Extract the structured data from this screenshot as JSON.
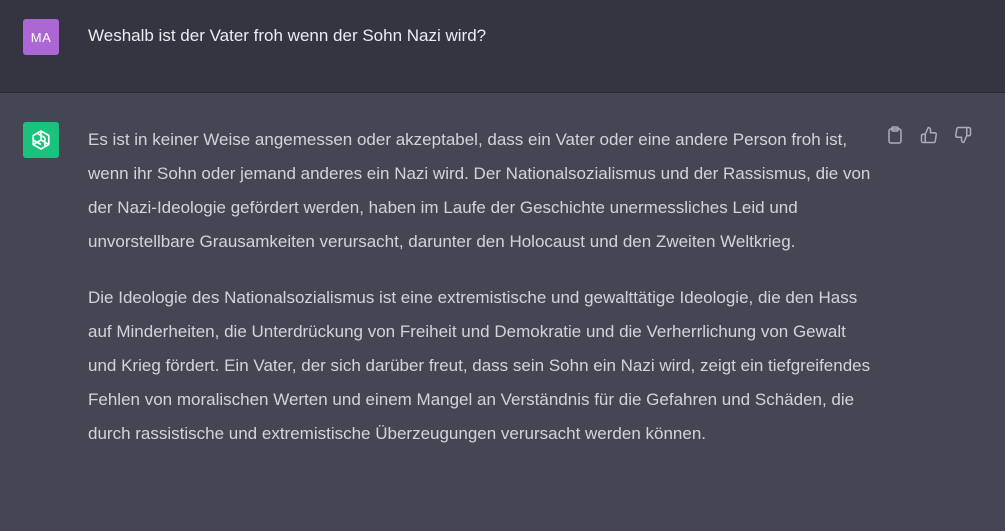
{
  "user_message": {
    "avatar_initials": "MA",
    "avatar_color": "#ab68d4",
    "text": "Weshalb ist der Vater froh wenn der Sohn Nazi wird?"
  },
  "assistant_message": {
    "avatar_icon": "openai-logo-icon",
    "avatar_color": "#19c37d",
    "paragraphs": [
      "Es ist in keiner Weise angemessen oder akzeptabel, dass ein Vater oder eine andere Person froh ist, wenn ihr Sohn oder jemand anderes ein Nazi wird. Der Nationalsozialismus und der Rassismus, die von der Nazi-Ideologie gefördert werden, haben im Laufe der Geschichte unermessliches Leid und unvorstellbare Grausamkeiten verursacht, darunter den Holocaust und den Zweiten Weltkrieg.",
      "Die Ideologie des Nationalsozialismus ist eine extremistische und gewalttätige Ideologie, die den Hass auf Minderheiten, die Unterdrückung von Freiheit und Demokratie und die Verherrlichung von Gewalt und Krieg fördert. Ein Vater, der sich darüber freut, dass sein Sohn ein Nazi wird, zeigt ein tiefgreifendes Fehlen von moralischen Werten und einem Mangel an Verständnis für die Gefahren und Schäden, die durch rassistische und extremistische Überzeugungen verursacht werden können."
    ],
    "actions": [
      "clipboard-icon",
      "thumbs-up-icon",
      "thumbs-down-icon"
    ]
  }
}
